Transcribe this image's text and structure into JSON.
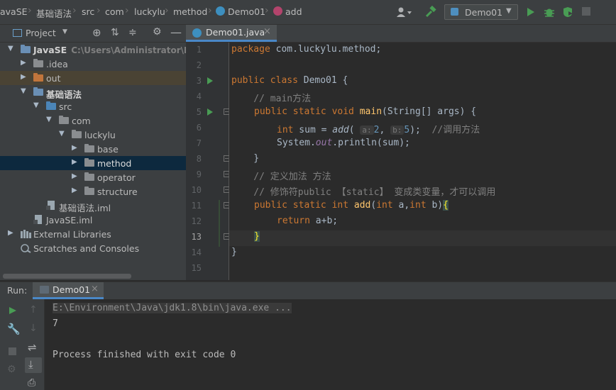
{
  "navbar": {
    "breadcrumbs": [
      "avaSE",
      "基础语法",
      "src",
      "com",
      "luckylu",
      "method",
      "Demo01",
      "add"
    ],
    "run_config": "Demo01"
  },
  "project": {
    "title": "Project",
    "tree": [
      {
        "label": "JavaSE",
        "sub": "C:\\Users\\Administrator\\Desk"
      },
      {
        "label": ".idea"
      },
      {
        "label": "out"
      },
      {
        "label": "基础语法"
      },
      {
        "label": "src"
      },
      {
        "label": "com"
      },
      {
        "label": "luckylu"
      },
      {
        "label": "base"
      },
      {
        "label": "method"
      },
      {
        "label": "operator"
      },
      {
        "label": "structure"
      },
      {
        "label": "基础语法.iml"
      },
      {
        "label": "JavaSE.iml"
      },
      {
        "label": "External Libraries"
      },
      {
        "label": "Scratches and Consoles"
      }
    ]
  },
  "editor": {
    "tab": "Demo01.java",
    "line_numbers": [
      "1",
      "2",
      "3",
      "4",
      "5",
      "6",
      "7",
      "8",
      "9",
      "10",
      "11",
      "12",
      "13",
      "14",
      "15"
    ],
    "code": {
      "l1_kw": "package",
      "l1_rest": " com.luckylu.method;",
      "l3_kw": "public class",
      "l3_rest": " Demo01 {",
      "l4": "    // main方法",
      "l5_kw": "public static void",
      "l5_fn": "main",
      "l5_rest": "(String[] args) {",
      "l6_kw": "int",
      "l6_a": " sum = ",
      "l6_fn": "add",
      "l6_h1": "a:",
      "l6_v1": "2",
      "l6_h2": "b:",
      "l6_v2": "5",
      "l6_end": ");",
      "l6_cm": "//调用方法",
      "l7_a": "System.",
      "l7_out": "out",
      "l7_b": ".println(sum);",
      "l8": "    }",
      "l9": "    // 定义加法 方法",
      "l10": "    // 修饰符public 【static】 变成类变量，才可以调用",
      "l11_kw": "public static int",
      "l11_fn": "add",
      "l11_b": "(",
      "l11_kw2": "int",
      "l11_c": " a,",
      "l11_kw3": "int",
      "l11_d": " b)",
      "l11_e": "{",
      "l12_kw": "return",
      "l12_rest": " a+b;",
      "l13": "}",
      "l14": "}"
    }
  },
  "run": {
    "label": "Run:",
    "tab": "Demo01",
    "output": [
      "E:\\Environment\\Java\\jdk1.8\\bin\\java.exe ...",
      "7",
      "",
      "Process finished with exit code 0"
    ]
  }
}
